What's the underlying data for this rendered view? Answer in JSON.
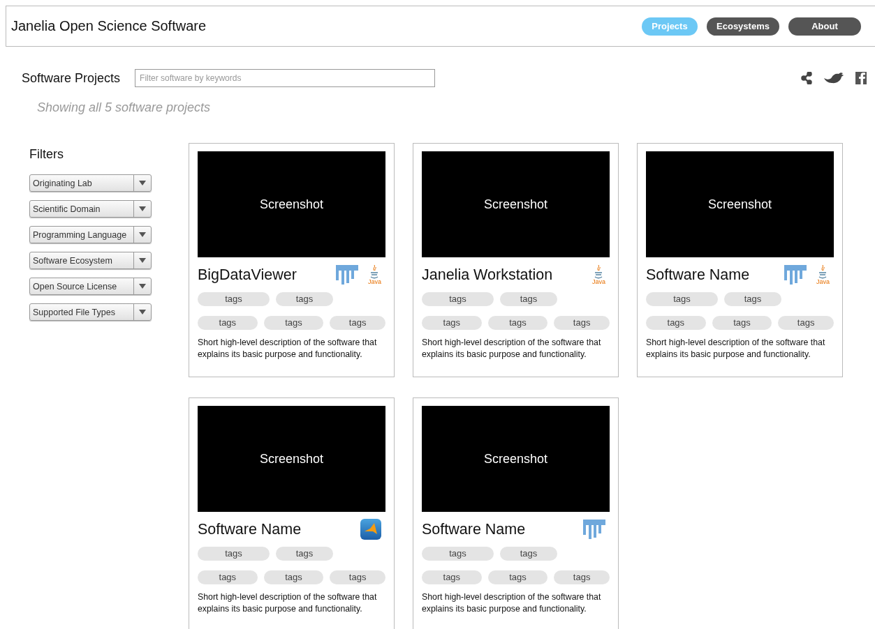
{
  "header": {
    "title": "Janelia Open Science Software",
    "nav": [
      {
        "label": "Projects",
        "selected": true
      },
      {
        "label": "Ecosystems",
        "selected": false
      },
      {
        "label": "About",
        "selected": false
      }
    ]
  },
  "toolbar": {
    "heading": "Software Projects",
    "search": {
      "placeholder": "Filter software by keywords"
    },
    "share_icons": [
      {
        "kind": "share"
      },
      {
        "kind": "twitter"
      },
      {
        "kind": "facebook"
      }
    ]
  },
  "summary": "Showing all 5 software projects",
  "filters": {
    "heading": "Filters",
    "dropdowns": [
      "Originating Lab",
      "Scientific Domain",
      "Programming Language",
      "Software Ecosystem",
      "Open Source License",
      "Supported File Types"
    ]
  },
  "projects": [
    {
      "screenshot": "Screenshot",
      "name": "BigDataViewer",
      "logos": [
        {
          "kind": "fiji"
        },
        {
          "kind": "java",
          "label": "Java"
        }
      ],
      "tag_rows": [
        [
          "tags",
          "tags"
        ],
        [
          "tags",
          "tags",
          "tags"
        ]
      ],
      "description": "Short high-level description of the software that explains its basic purpose and functionality."
    },
    {
      "screenshot": "Screenshot",
      "name": "Janelia Workstation",
      "logos": [
        {
          "kind": "java",
          "label": "Java"
        }
      ],
      "tag_rows": [
        [
          "tags",
          "tags"
        ],
        [
          "tags",
          "tags",
          "tags"
        ]
      ],
      "description": "Short high-level description of the software that explains its basic purpose and functionality."
    },
    {
      "screenshot": "Screenshot",
      "name": "Software Name",
      "logos": [
        {
          "kind": "fiji"
        },
        {
          "kind": "java",
          "label": "Java"
        }
      ],
      "tag_rows": [
        [
          "tags",
          "tags"
        ],
        [
          "tags",
          "tags",
          "tags"
        ]
      ],
      "description": "Short high-level description of the software that explains its basic purpose and functionality."
    },
    {
      "screenshot": "Screenshot",
      "name": "Software Name",
      "logos": [
        {
          "kind": "matlab"
        }
      ],
      "tag_rows": [
        [
          "tags",
          "tags"
        ],
        [
          "tags",
          "tags",
          "tags"
        ]
      ],
      "description": "Short high-level description of the software that explains its basic purpose and functionality."
    },
    {
      "screenshot": "Screenshot",
      "name": "Software Name",
      "logos": [
        {
          "kind": "fiji"
        }
      ],
      "tag_rows": [
        [
          "tags",
          "tags"
        ],
        [
          "tags",
          "tags",
          "tags"
        ]
      ],
      "description": "Short high-level description of the software that explains its basic purpose and functionality."
    }
  ]
}
